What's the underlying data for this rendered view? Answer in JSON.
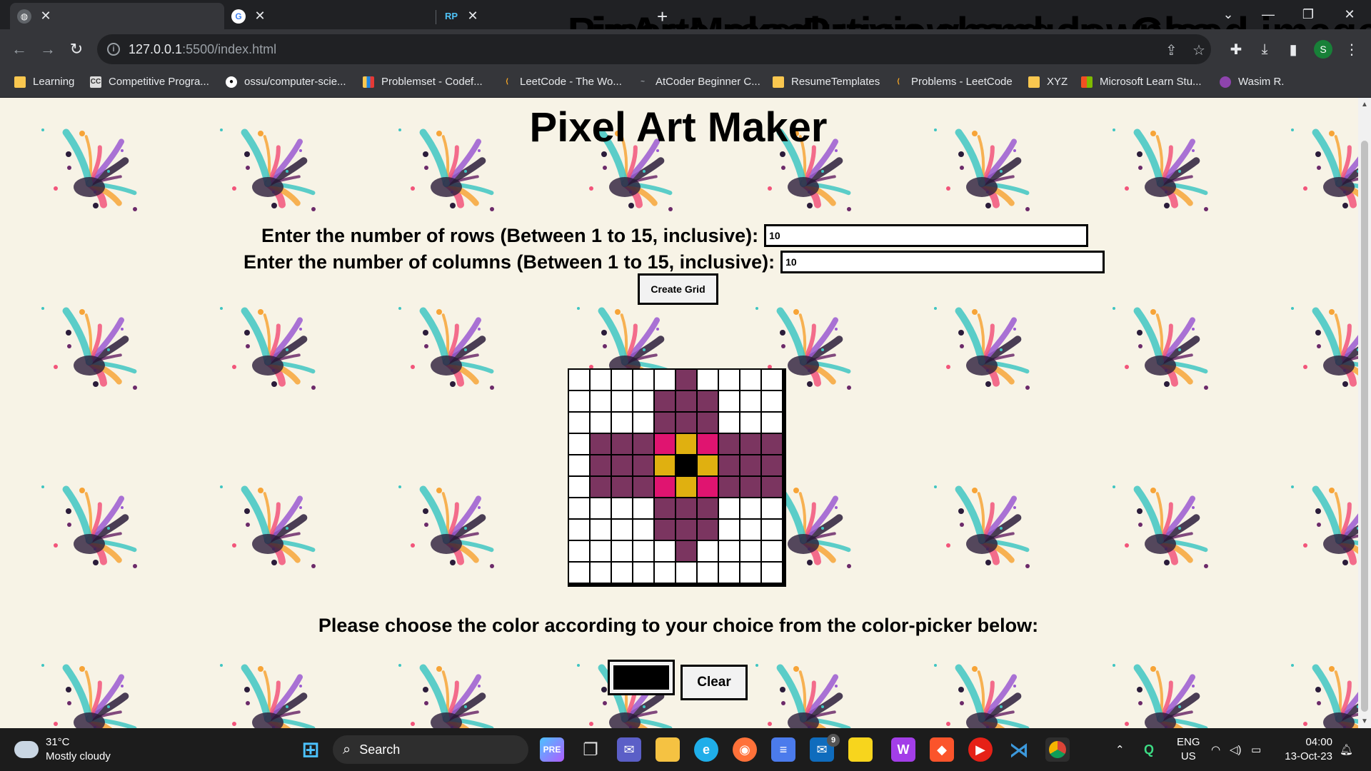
{
  "browser": {
    "tabs": [
      {
        "title": "PixArtMaker",
        "active": true
      },
      {
        "title": "image resolution changer - Goo",
        "active": false
      },
      {
        "title": "Preview and download image - I",
        "active": false
      }
    ],
    "url_host": "127.0.0.1",
    "url_path": ":5500/index.html",
    "profile_initial": "S",
    "bookmarks": [
      "Learning",
      "Competitive Progra...",
      "ossu/computer-scie...",
      "Problemset - Codef...",
      "LeetCode - The Wo...",
      "AtCoder Beginner C...",
      "ResumeTemplates",
      "Problems - LeetCode",
      "XYZ",
      "Microsoft Learn Stu...",
      "Wasim R."
    ]
  },
  "page": {
    "title": "Pixel Art Maker",
    "rows_label": "Enter the number of rows (Between 1 to 15, inclusive):",
    "rows_value": "10",
    "cols_label": "Enter the number of columns (Between 1 to 15, inclusive):",
    "cols_value": "10",
    "create_button": "Create Grid",
    "prompt": "Please choose the color according to your choice from the color-picker below:",
    "picker_color": "#000000",
    "clear_button": "Clear",
    "palette": {
      "0": "#ffffff",
      "P": "#7b3560",
      "M": "#e01470",
      "Y": "#e0b010",
      "K": "#000000"
    },
    "grid": [
      "00000P0000",
      "0000PPP000",
      "0000PPP000",
      "0PPPMYMPPP",
      "0PPPYKYPPP",
      "0PPPMYMPPP",
      "0000PPP000",
      "0000PPP000",
      "00000P0000",
      "0000000000"
    ]
  },
  "taskbar": {
    "temperature": "31°C",
    "weather": "Mostly cloudy",
    "search_label": "Search",
    "lang_top": "ENG",
    "lang_bottom": "US",
    "time": "04:00",
    "date": "13-Oct-23",
    "mail_badge": "9"
  }
}
